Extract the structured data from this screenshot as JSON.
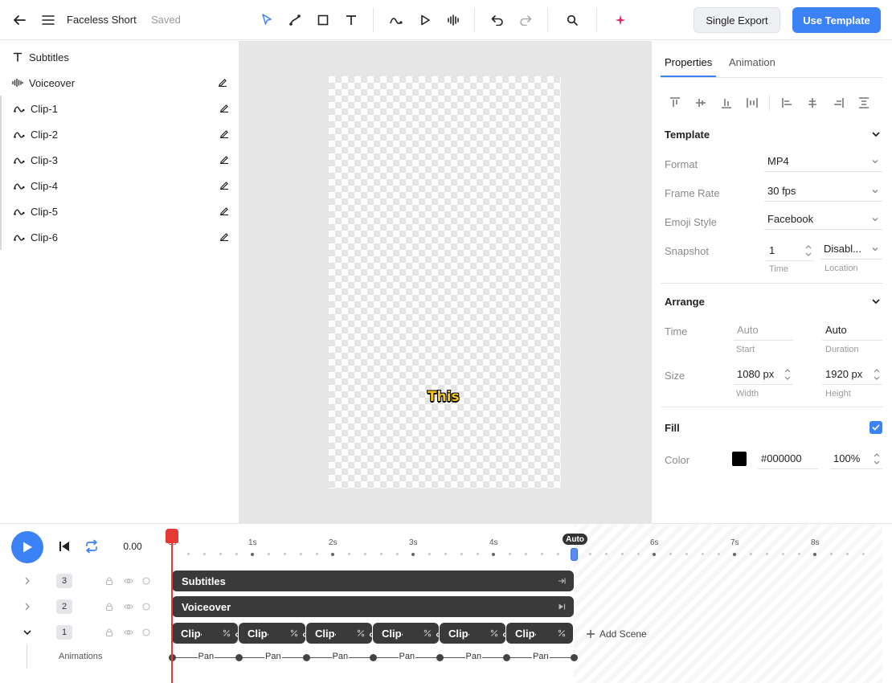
{
  "header": {
    "title": "Faceless Short",
    "status": "Saved",
    "single_export": "Single Export",
    "use_template": "Use Template"
  },
  "layers": [
    {
      "label": "Subtitles",
      "icon": "text-icon",
      "editable": false
    },
    {
      "label": "Voiceover",
      "icon": "waveform-icon",
      "editable": true
    },
    {
      "label": "Clip-1",
      "icon": "motion-path-icon",
      "editable": true
    },
    {
      "label": "Clip-2",
      "icon": "motion-path-icon",
      "editable": true
    },
    {
      "label": "Clip-3",
      "icon": "motion-path-icon",
      "editable": true
    },
    {
      "label": "Clip-4",
      "icon": "motion-path-icon",
      "editable": true
    },
    {
      "label": "Clip-5",
      "icon": "motion-path-icon",
      "editable": true
    },
    {
      "label": "Clip-6",
      "icon": "motion-path-icon",
      "editable": true
    }
  ],
  "canvas": {
    "caption": "This",
    "caption_color": "#f5c518"
  },
  "properties": {
    "tabs": [
      "Properties",
      "Animation"
    ],
    "template": {
      "heading": "Template",
      "format_label": "Format",
      "format_value": "MP4",
      "frame_rate_label": "Frame Rate",
      "frame_rate_value": "30 fps",
      "emoji_label": "Emoji Style",
      "emoji_value": "Facebook",
      "snapshot_label": "Snapshot",
      "snapshot_time": "1",
      "snapshot_location": "Disabl...",
      "time_sub": "Time",
      "location_sub": "Location"
    },
    "arrange": {
      "heading": "Arrange",
      "time_label": "Time",
      "start_value": "Auto",
      "duration_value": "Auto",
      "start_sub": "Start",
      "duration_sub": "Duration",
      "size_label": "Size",
      "width_value": "1080 px",
      "height_value": "1920 px",
      "width_sub": "Width",
      "height_sub": "Height"
    },
    "fill": {
      "heading": "Fill",
      "checked": true,
      "color_label": "Color",
      "color_hex": "#000000",
      "opacity": "100%"
    }
  },
  "timeline": {
    "time": "0.00",
    "ticks": [
      "0s",
      "1s",
      "2s",
      "3s",
      "4s",
      "6s",
      "7s",
      "8s"
    ],
    "auto_badge": "Auto",
    "rows": [
      {
        "num": "3",
        "track": "Subtitles"
      },
      {
        "num": "2",
        "track": "Voiceover"
      },
      {
        "num": "1"
      }
    ],
    "clips": [
      "Clip-",
      "Clip-",
      "Clip-",
      "Clip-",
      "Clip-",
      "Clip-"
    ],
    "add_scene": "Add Scene",
    "animations_label": "Animations",
    "pan_labels": [
      "Pan",
      "Pan",
      "Pan",
      "Pan",
      "Pan",
      "Pan"
    ],
    "accent": "#3b82f6",
    "playhead_color": "#e53935"
  }
}
